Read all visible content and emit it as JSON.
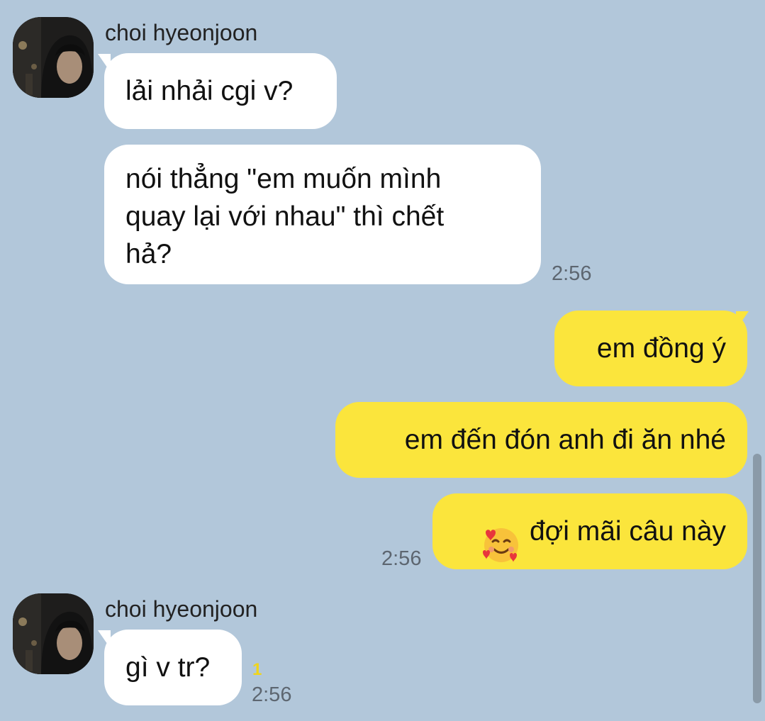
{
  "contact": {
    "name": "choi hyeonjoon"
  },
  "messages": {
    "m1": "lải nhải cgi v?",
    "m2": "nói thẳng \"em muốn mình\nquay lại với nhau\" thì chết\nhả?",
    "m3": "em đồng ý",
    "m4": "em đến đón anh đi ăn nhé",
    "m5": "đợi mãi câu này",
    "m6": "gì v tr?"
  },
  "meta": {
    "time_1": "2:56",
    "time_2": "2:56",
    "time_3": "2:56",
    "unread_count": "1"
  },
  "icons": {
    "emoji": "smiling-face-with-hearts-icon"
  },
  "colors": {
    "background": "#b2c7da",
    "incoming_bubble": "#ffffff",
    "outgoing_bubble": "#fbe53c",
    "unread_badge": "#f0d51a"
  }
}
